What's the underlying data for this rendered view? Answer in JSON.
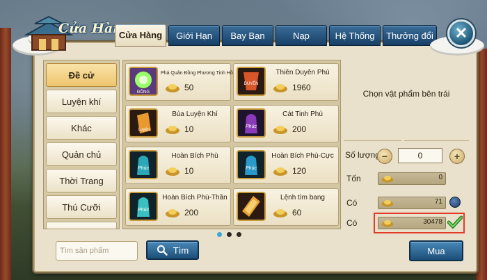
{
  "header": {
    "title": "Cửa Hàng",
    "tabs": [
      {
        "label": "Cửa Hàng",
        "active": true
      },
      {
        "label": "Giới Hạn",
        "active": false
      },
      {
        "label": "Bay Bạn",
        "active": false
      },
      {
        "label": "Nạp",
        "active": false
      },
      {
        "label": "Hệ Thống",
        "active": false
      },
      {
        "label": "Thưởng đổi",
        "active": false
      }
    ],
    "close_icon": "close-x-icon"
  },
  "sidebar": {
    "items": [
      {
        "label": "Đề cử",
        "active": true
      },
      {
        "label": "Luyện khí"
      },
      {
        "label": "Khác"
      },
      {
        "label": "Quản chủ"
      },
      {
        "label": "Thời Trang"
      },
      {
        "label": "Thú Cưỡi"
      }
    ]
  },
  "items": [
    {
      "name": "Phá Quân Đồng Phương Tinh Hồn",
      "price": "50",
      "icon": "green-orb-icon",
      "tag": "ĐỒNG"
    },
    {
      "name": "Thiên Duyên Phù",
      "price": "1960",
      "icon": "red-talisman-icon",
      "tag": "DUYÊN"
    },
    {
      "name": "Bùa Luyện Khí",
      "price": "10",
      "icon": "orange-scroll-icon",
      "tag": "Luyện"
    },
    {
      "name": "Cát Tinh Phù",
      "price": "200",
      "icon": "purple-talisman-icon",
      "tag": "Phúc"
    },
    {
      "name": "Hoàn Bích Phù",
      "price": "10",
      "icon": "teal-talisman-icon",
      "tag": "Phúc"
    },
    {
      "name": "Hoàn Bích Phù-Cực",
      "price": "120",
      "icon": "teal-talisman-icon",
      "tag": "Phúc"
    },
    {
      "name": "Hoàn Bích Phù-Thần",
      "price": "200",
      "icon": "teal-talisman-icon",
      "tag": "Phúc"
    },
    {
      "name": "Lệnh tìm bang",
      "price": "60",
      "icon": "gold-token-icon",
      "tag": ""
    }
  ],
  "pagination": {
    "pages": 3,
    "current": 1
  },
  "search": {
    "placeholder": "Tìm sản phẩm",
    "value": "",
    "button_label": "Tìm"
  },
  "detail": {
    "hint": "Chọn vật phẩm bên trái",
    "quantity_label": "Số lượng",
    "quantity_value": "0",
    "minus_label": "−",
    "plus_label": "+",
    "total_label": "Tốn",
    "total_value": "0",
    "have1_label": "Có",
    "have1_value": "71",
    "have2_label": "Có",
    "have2_value": "30478",
    "buy_label": "Mua"
  },
  "colors": {
    "accent_blue": "#1b4e78",
    "highlight_red": "#e23a2a",
    "gold": "#e2b448"
  }
}
